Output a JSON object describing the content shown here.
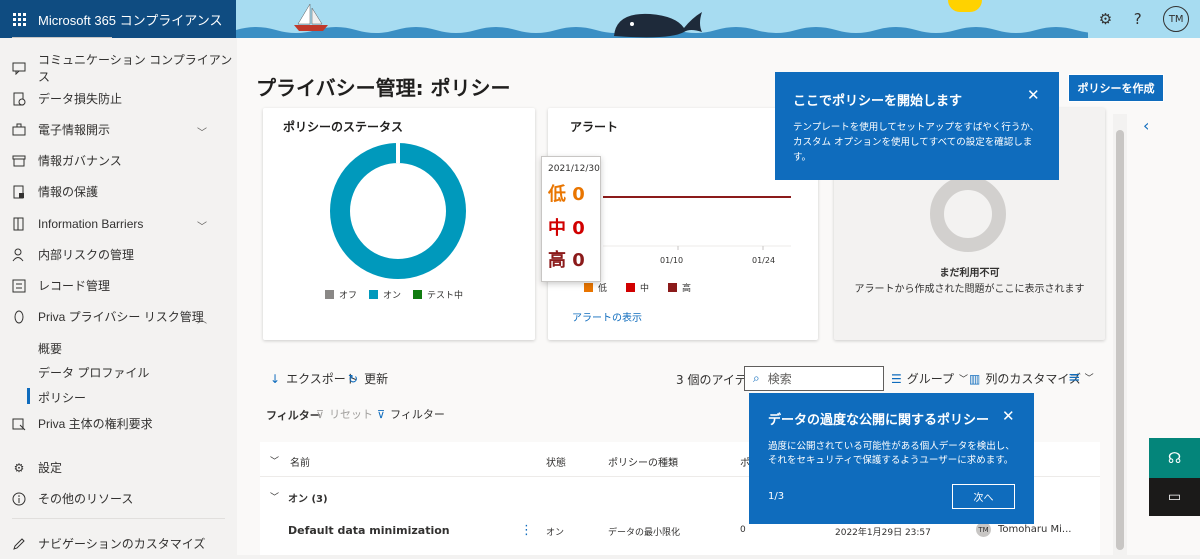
{
  "header": {
    "app_title": "Microsoft 365 コンプライアンス",
    "avatar_initials": "TM",
    "icons": [
      "waffle-icon",
      "settings-icon",
      "help-icon"
    ]
  },
  "nav": {
    "items": [
      {
        "label": "コミュニケーション コンプライアンス",
        "icon": "chat-icon"
      },
      {
        "label": "データ損失防止",
        "icon": "shield-doc-icon"
      },
      {
        "label": "電子情報開示",
        "icon": "briefcase-icon"
      },
      {
        "label": "情報ガバナンス",
        "icon": "archive-icon"
      },
      {
        "label": "情報の保護",
        "icon": "lock-doc-icon"
      },
      {
        "label": "Information Barriers",
        "icon": "barrier-icon"
      },
      {
        "label": "内部リスクの管理",
        "icon": "person-icon"
      },
      {
        "label": "レコード管理",
        "icon": "records-icon"
      },
      {
        "label": "Priva プライバシー リスク管理",
        "icon": "privacy-icon"
      },
      {
        "label": "Priva 主体の権利要求",
        "icon": "request-icon"
      },
      {
        "label": "設定",
        "icon": "gear-icon"
      },
      {
        "label": "その他のリソース",
        "icon": "info-icon"
      },
      {
        "label": "ナビゲーションのカスタマイズ",
        "icon": "pencil-icon"
      }
    ],
    "sub_items": [
      "概要",
      "データ プロファイル",
      "ポリシー"
    ]
  },
  "page": {
    "title": "プライバシー管理: ポリシー"
  },
  "cards": {
    "status": {
      "title": "ポリシーのステータス",
      "legend": [
        "オフ",
        "オン",
        "テスト中"
      ]
    },
    "alerts": {
      "title": "アラート",
      "view_link": "アラートの表示",
      "legend": [
        "低",
        "中",
        "高"
      ],
      "ticks": [
        "01/10",
        "01/24"
      ]
    },
    "issues": {
      "unavailable_title": "まだ利用不可",
      "unavailable_text": "アラートから作成された問題がここに表示されます"
    }
  },
  "chart_data": [
    {
      "type": "pie",
      "title": "ポリシーのステータス",
      "categories": [
        "オフ",
        "オン",
        "テスト中"
      ],
      "values": [
        0,
        1,
        0
      ],
      "colors": [
        "#8a8886",
        "#0099bc",
        "#107c10"
      ]
    },
    {
      "type": "line",
      "title": "アラート",
      "x": [
        "01/10",
        "01/24"
      ],
      "series": [
        {
          "name": "低",
          "values": [
            0,
            0
          ]
        },
        {
          "name": "中",
          "values": [
            0,
            0
          ]
        },
        {
          "name": "高",
          "values": [
            0,
            0
          ]
        }
      ]
    }
  ],
  "tooltip": {
    "date": "2021/12/30",
    "low_label": "低",
    "low_value": "0",
    "mid_label": "中",
    "mid_value": "0",
    "high_label": "高",
    "high_value": "0"
  },
  "teaching1": {
    "title": "ここでポリシーを開始します",
    "body": "テンプレートを使用してセットアップをすばやく行うか、カスタム オプションを使用してすべての設定を確認します。"
  },
  "create_button": "ポリシーを作成",
  "toolbar": {
    "export": "エクスポート",
    "refresh": "更新",
    "item_count": "3 個のアイテム",
    "search_placeholder": "検索",
    "group": "グループ",
    "customize_columns": "列のカスタマイズ"
  },
  "filters": {
    "label": "フィルター",
    "reset": "リセット",
    "filter": "フィルター"
  },
  "teaching2": {
    "title": "データの過度な公開に関するポリシー",
    "body": "過度に公開されている可能性がある個人データを検出し、それをセキュリティで保護するようユーザーに求めます。",
    "page": "1/3",
    "next": "次へ"
  },
  "table": {
    "columns": [
      "名前",
      "状態",
      "ポリシーの種類",
      "ポ"
    ],
    "group": "オン (3)",
    "rows": [
      {
        "name": "Default data minimization",
        "status": "オン",
        "type": "データの最小限化",
        "count": "0",
        "date": "2022年1月29日 23:57",
        "owner_initials": "TM",
        "owner": "Tomoharu Mi..."
      }
    ]
  },
  "colors": {
    "accent": "#0f6cbd",
    "brand": "#0f4c81",
    "donut": "#0099bc",
    "low": "#e97500",
    "mid": "#d10000",
    "high": "#8b1a1a"
  }
}
